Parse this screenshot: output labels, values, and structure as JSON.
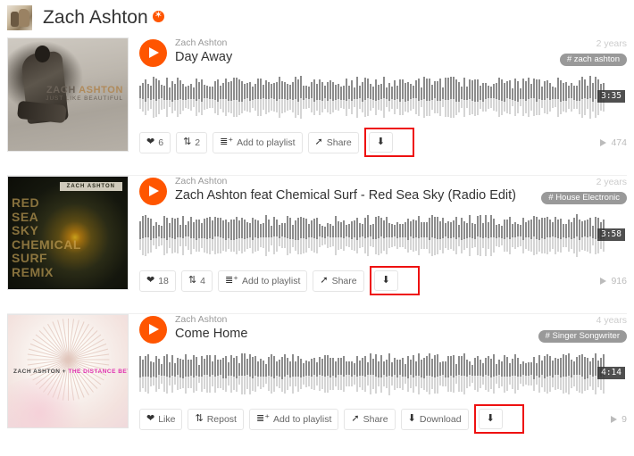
{
  "header": {
    "profile_name": "Zach Ashton",
    "avatar_alt": "profile-avatar",
    "pro_badge": "✶"
  },
  "labels": {
    "add_to_playlist": "Add to playlist",
    "share": "Share",
    "download": "Download",
    "like": "Like",
    "repost": "Repost"
  },
  "tracks": [
    {
      "uploader": "Zach Ashton",
      "title": "Day Away",
      "time_ago": "2 years",
      "genre": "# zach ashton",
      "duration": "3:35",
      "plays": "474",
      "likes": "6",
      "reposts": "2",
      "artwork": {
        "line1_a": "ZACH ",
        "line1_b": "ASHTON",
        "line2": "JUST LIKE BEAUTIFUL"
      }
    },
    {
      "uploader": "Zach Ashton",
      "title": "Zach Ashton feat Chemical Surf - Red Sea Sky  (Radio Edit)",
      "time_ago": "2 years",
      "genre": "# House Electronic",
      "duration": "3:58",
      "plays": "916",
      "likes": "18",
      "reposts": "4",
      "artwork": {
        "tag": "ZACH ASHTON",
        "text": "RED\nSEA\nSKY\nCHEMICAL\nSURF\nREMIX"
      }
    },
    {
      "uploader": "Zach Ashton",
      "title": "Come Home",
      "time_ago": "4 years",
      "genre": "# Singer Songwriter",
      "duration": "4:14",
      "plays": "9",
      "likes": "Like",
      "reposts": "Repost",
      "artwork": {
        "text_a": "ZACH ASHTON + ",
        "text_b": "THE DISTANCE BETWEEN US"
      }
    }
  ],
  "colors": {
    "accent_orange": "#ff5500",
    "highlight_red": "#ee1111",
    "tag_gray": "#999999"
  }
}
